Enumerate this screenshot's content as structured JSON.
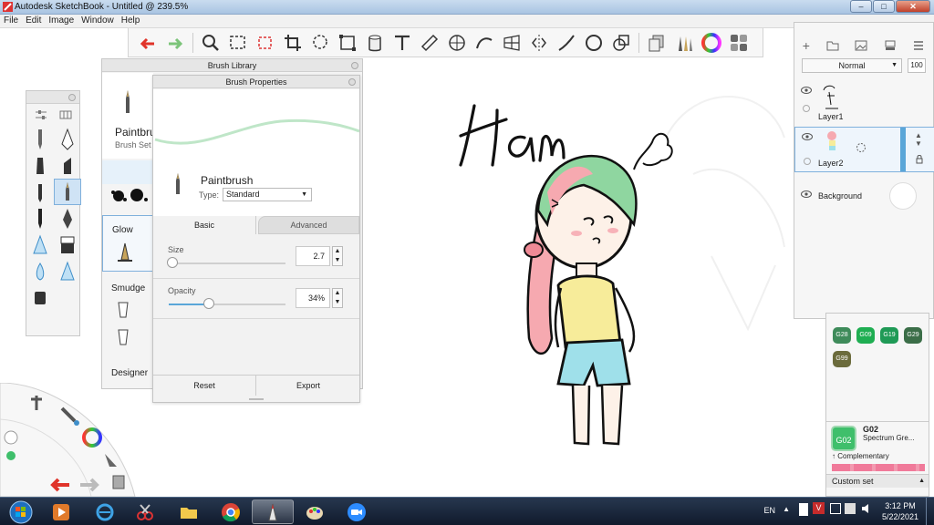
{
  "window": {
    "title": "Autodesk SketchBook - Untitled @ 239.5%",
    "controls": [
      "minimize",
      "maximize",
      "close"
    ]
  },
  "menu": [
    "File",
    "Edit",
    "Image",
    "Window",
    "Help"
  ],
  "toolbar": {
    "icons": [
      "undo-icon",
      "redo-icon",
      "zoom-icon",
      "rect-select-icon",
      "select-icon",
      "crop-icon",
      "lasso-icon",
      "transform-icon",
      "fill-icon",
      "text-icon",
      "ruler-icon",
      "ellipse-guide-icon",
      "french-curve-icon",
      "perspective-icon",
      "symmetry-icon",
      "stroke-icon",
      "circle-icon",
      "shape-icon",
      "copy-icon",
      "brush-library-icon",
      "color-wheel-icon",
      "palette-icon"
    ]
  },
  "brush_library": {
    "title": "Brush Library",
    "brush_name": "Paintbrush",
    "brush_set": "Brush Set",
    "sections": [
      "Glow",
      "Smudge",
      "Designer"
    ]
  },
  "brush_properties": {
    "title": "Brush Properties",
    "brush_name": "Paintbrush",
    "type_label": "Type:",
    "type_value": "Standard",
    "tabs": [
      "Basic",
      "Advanced"
    ],
    "size_label": "Size",
    "size_value": "2.7",
    "opacity_label": "Opacity",
    "opacity_value": "34%",
    "size_fraction": 0.03,
    "opacity_fraction": 0.34,
    "reset_label": "Reset",
    "export_label": "Export"
  },
  "canvas": {
    "handwritten_text": "Ham"
  },
  "layers": {
    "blend_mode": "Normal",
    "opacity": "100",
    "items": [
      {
        "name": "Layer1"
      },
      {
        "name": "Layer2"
      },
      {
        "name": "Background"
      }
    ]
  },
  "colors": {
    "swatches": [
      {
        "code": "G28",
        "color": "#3e8b5a"
      },
      {
        "code": "G09",
        "color": "#1fae52"
      },
      {
        "code": "G19",
        "color": "#1f9a56"
      },
      {
        "code": "G29",
        "color": "#3b6e48"
      },
      {
        "code": "G99",
        "color": "#6b6b3c"
      }
    ],
    "current_code": "G02",
    "current_color": "#3fbf6b",
    "current_name": "Spectrum Gre...",
    "complementary_label": "Complementary",
    "custom_set_label": "Custom set"
  },
  "taskbar": {
    "apps": [
      "start-orb",
      "media-player",
      "internet-explorer",
      "snipping-tool",
      "file-explorer",
      "chrome",
      "sketchbook",
      "paint",
      "zoom"
    ],
    "language": "EN",
    "time": "3:12 PM",
    "date": "5/22/2021"
  }
}
